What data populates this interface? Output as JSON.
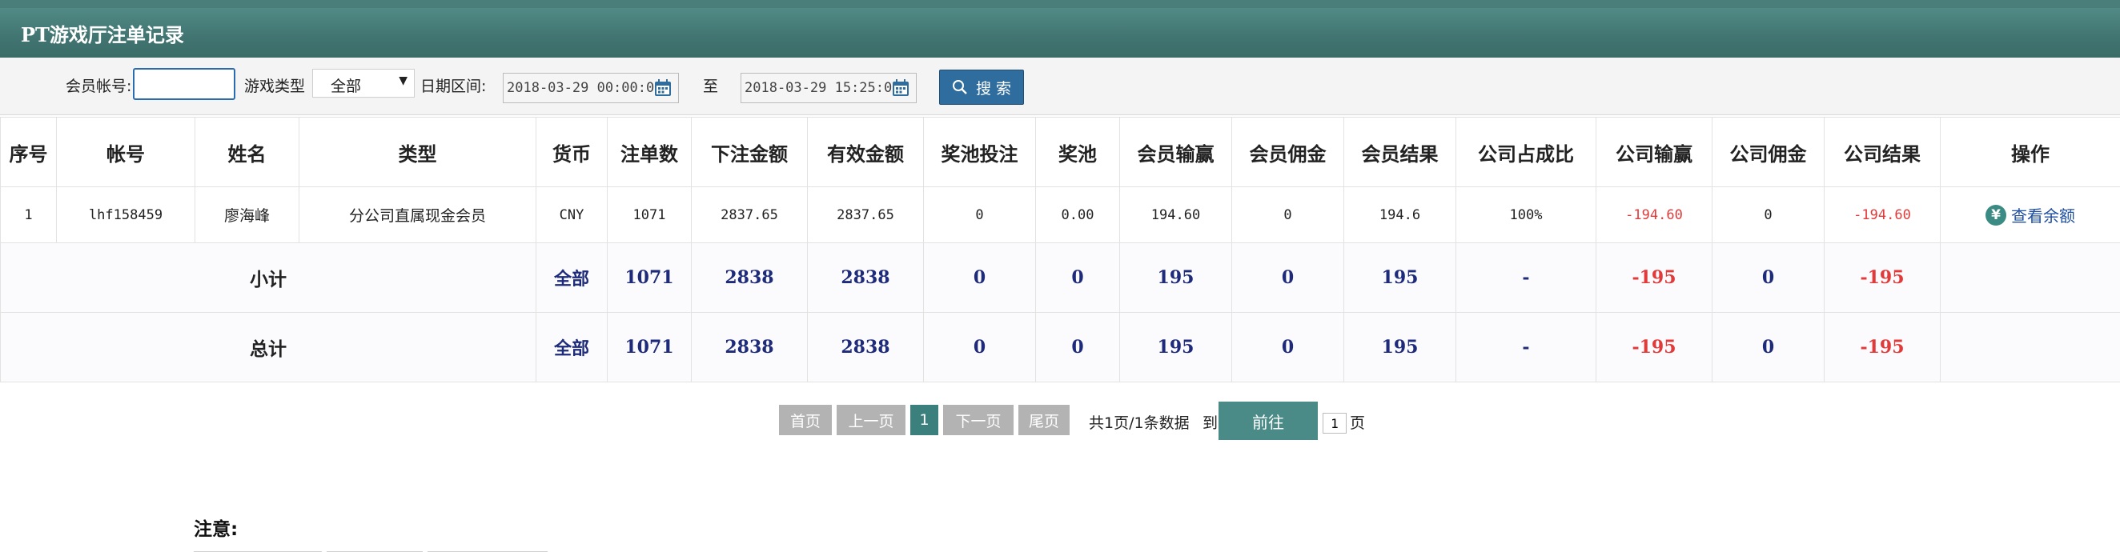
{
  "header": {
    "title": "PT游戏厅注单记录"
  },
  "filters": {
    "account_label": "会员帐号:",
    "account_value": "",
    "game_type_label": "游戏类型",
    "game_type_selected": "全部",
    "date_label": "日期区间:",
    "date_from": "2018-03-29 00:00:00",
    "to_label": "至",
    "date_to": "2018-03-29 15:25:00",
    "search_label": "搜 索"
  },
  "table": {
    "columns": [
      "序号",
      "帐号",
      "姓名",
      "类型",
      "货币",
      "注单数",
      "下注金额",
      "有效金额",
      "奖池投注",
      "奖池",
      "会员输赢",
      "会员佣金",
      "会员结果",
      "公司占成比",
      "公司输赢",
      "公司佣金",
      "公司结果",
      "操作"
    ],
    "row": {
      "index": "1",
      "account": "lhf158459",
      "name": "廖海峰",
      "type": "分公司直属现金会员",
      "currency": "CNY",
      "bet_count": "1071",
      "bet_amount": "2837.65",
      "valid_amount": "2837.65",
      "jackpot_bet": "0",
      "jackpot": "0.00",
      "member_winloss": "194.60",
      "member_commission": "0",
      "member_result": "194.6",
      "company_share": "100%",
      "company_winloss": "-194.60",
      "company_commission": "0",
      "company_result": "-194.60",
      "action_label": "查看余额"
    },
    "subtotal": {
      "label": "小计",
      "currency": "全部",
      "bet_count": "1071",
      "bet_amount": "2838",
      "valid_amount": "2838",
      "jackpot_bet": "0",
      "jackpot": "0",
      "member_winloss": "195",
      "member_commission": "0",
      "member_result": "195",
      "company_share": "-",
      "company_winloss": "-195",
      "company_commission": "0",
      "company_result": "-195"
    },
    "total": {
      "label": "总计",
      "currency": "全部",
      "bet_count": "1071",
      "bet_amount": "2838",
      "valid_amount": "2838",
      "jackpot_bet": "0",
      "jackpot": "0",
      "member_winloss": "195",
      "member_commission": "0",
      "member_result": "195",
      "company_share": "-",
      "company_winloss": "-195",
      "company_commission": "0",
      "company_result": "-195"
    }
  },
  "pagination": {
    "first": "首页",
    "prev": "上一页",
    "current": "1",
    "next": "下一页",
    "last": "尾页",
    "summary": "共1页/1条数据",
    "goto_label": "到",
    "go_button": "前往",
    "page_value": "1",
    "page_unit": "页"
  },
  "note": {
    "title": "注意:"
  },
  "colors": {
    "header": "#427673",
    "accent": "#3b807c",
    "negative": "#e23a3a",
    "link": "#2255aa"
  },
  "icons": {
    "calendar": "calendar-icon",
    "search": "search-icon",
    "balance": "yen-icon"
  }
}
